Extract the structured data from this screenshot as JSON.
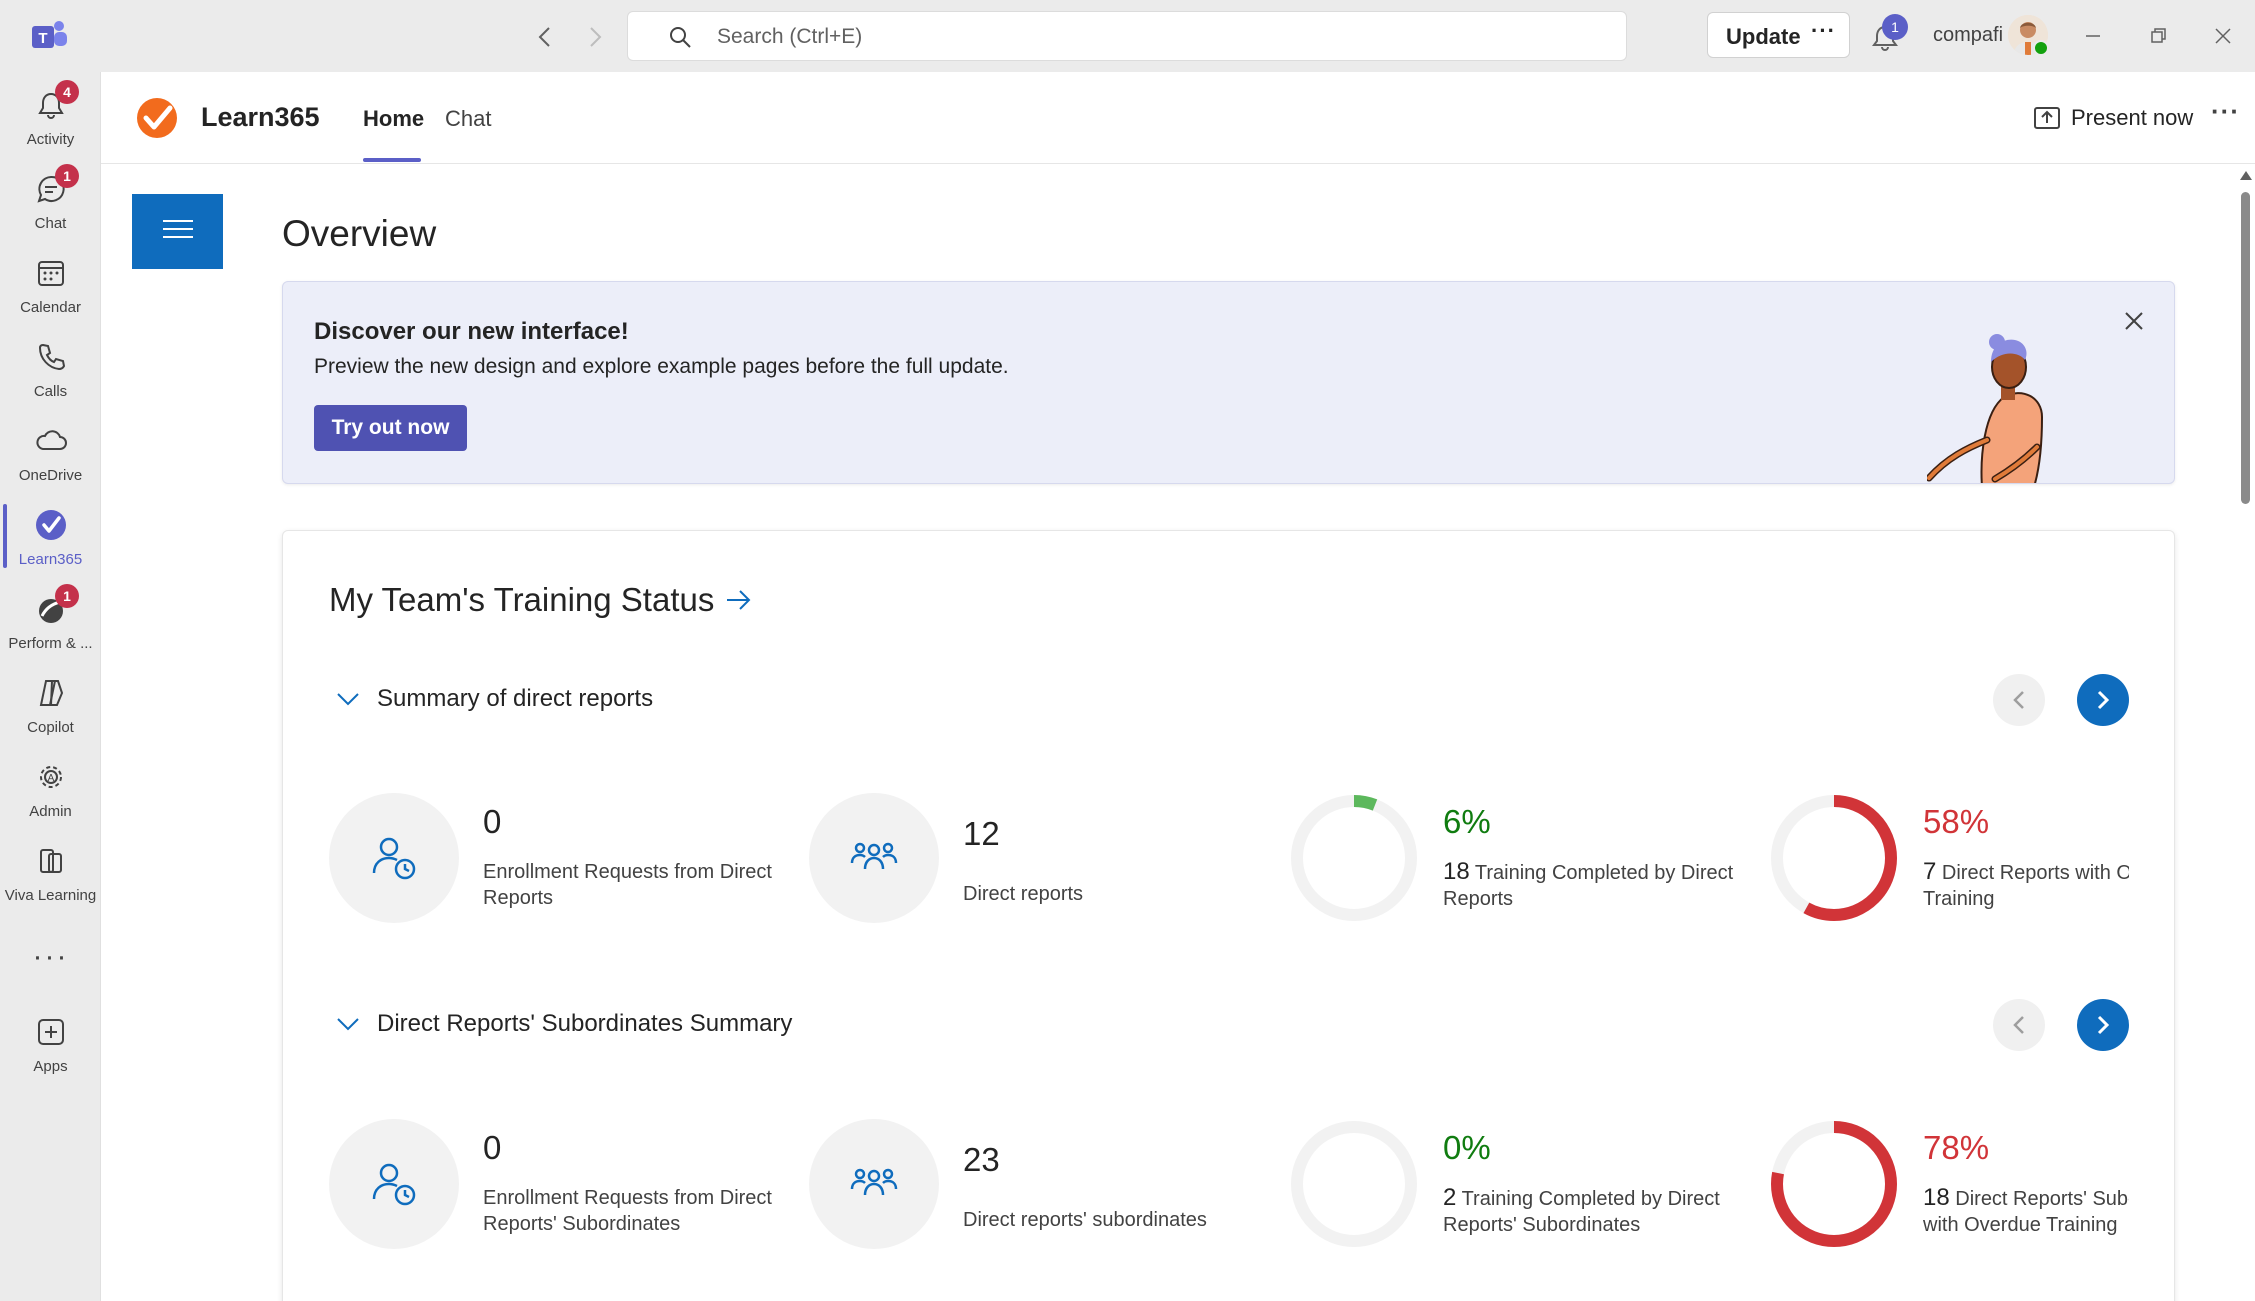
{
  "titlebar": {
    "search_placeholder": "Search (Ctrl+E)",
    "update_label": "Update",
    "update_more": "···",
    "notification_count": "1",
    "account_name": "compafi"
  },
  "appbar": {
    "items": [
      {
        "label": "Activity",
        "icon": "bell-icon",
        "badge": "4"
      },
      {
        "label": "Chat",
        "icon": "chat-icon",
        "badge": "1"
      },
      {
        "label": "Calendar",
        "icon": "calendar-icon",
        "badge": ""
      },
      {
        "label": "Calls",
        "icon": "phone-icon",
        "badge": ""
      },
      {
        "label": "OneDrive",
        "icon": "cloud-icon",
        "badge": ""
      },
      {
        "label": "Learn365",
        "icon": "learn365-icon",
        "badge": ""
      },
      {
        "label": "Perform & ...",
        "icon": "perform-icon",
        "badge": "1"
      },
      {
        "label": "Copilot",
        "icon": "copilot-icon",
        "badge": ""
      },
      {
        "label": "Admin",
        "icon": "admin-gear-icon",
        "badge": ""
      },
      {
        "label": "Viva Learning",
        "icon": "viva-learning-icon",
        "badge": ""
      }
    ],
    "more": "···",
    "apps_label": "Apps"
  },
  "header": {
    "app_title": "Learn365",
    "tabs": [
      {
        "label": "Home",
        "active": true
      },
      {
        "label": "Chat",
        "active": false
      }
    ],
    "present_label": "Present now",
    "more": "···"
  },
  "page": {
    "title": "Overview",
    "banner": {
      "title": "Discover our new interface!",
      "description": "Preview the new design and explore example pages before the full update.",
      "button": "Try out now"
    },
    "card": {
      "title": "My Team's Training Status",
      "sections": [
        {
          "label": "Summary of direct reports",
          "stats": [
            {
              "value": "0",
              "desc": "Enrollment Requests from Direct Reports",
              "icon": "person-clock-icon"
            },
            {
              "value": "12",
              "desc": "Direct reports",
              "icon": "people-team-icon"
            },
            {
              "percent": "6%",
              "count": "18",
              "desc": "Training Completed by Direct Reports",
              "fraction": 0.06,
              "color": "#5cb85c"
            },
            {
              "percent": "58%",
              "count": "7",
              "desc": "Direct Reports with Overdue Training",
              "fraction": 0.58,
              "color": "#d13438"
            }
          ]
        },
        {
          "label": "Direct Reports' Subordinates Summary",
          "stats": [
            {
              "value": "0",
              "desc": "Enrollment Requests from Direct Reports' Subordinates",
              "icon": "person-clock-icon"
            },
            {
              "value": "23",
              "desc": "Direct reports' subordinates",
              "icon": "people-team-icon"
            },
            {
              "percent": "0%",
              "count": "2",
              "desc": "Training Completed by Direct Reports' Subordinates",
              "fraction": 0.0,
              "color": "#5cb85c"
            },
            {
              "percent": "78%",
              "count": "18",
              "desc": "Direct Reports' Subordinates with Overdue Training",
              "fraction": 0.78,
              "color": "#d13438"
            }
          ]
        }
      ]
    }
  },
  "colors": {
    "accent": "#5b5fc7",
    "brand_blue": "#0f6cbd",
    "learn365_orange": "#f26b1d",
    "positive": "#107c10",
    "negative": "#d13438"
  }
}
